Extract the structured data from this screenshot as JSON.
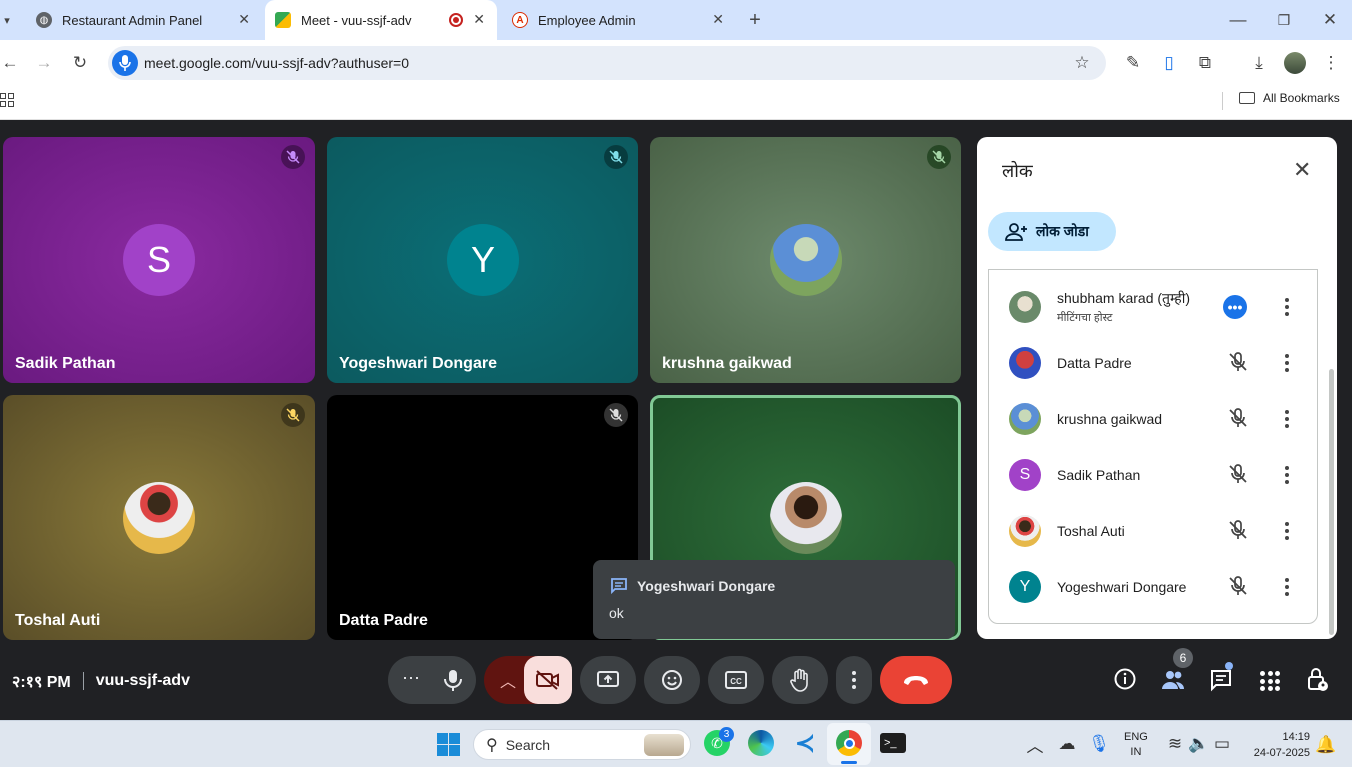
{
  "browser": {
    "tabs": [
      {
        "title": "Restaurant Admin Panel"
      },
      {
        "title": "Meet - vuu-ssjf-adv"
      },
      {
        "title": "Employee Admin"
      }
    ],
    "url": "meet.google.com/vuu-ssjf-adv?authuser=0",
    "bookmarks_label": "All Bookmarks"
  },
  "tiles": [
    {
      "name": "Sadik Pathan",
      "avatar_letter": "S",
      "color": "#a142c8"
    },
    {
      "name": "Yogeshwari Dongare",
      "avatar_letter": "Y",
      "color": "#00838f"
    },
    {
      "name": "krushna gaikwad"
    },
    {
      "name": "Toshal Auti"
    },
    {
      "name": "Datta Padre"
    },
    {
      "name": ""
    }
  ],
  "chat_toast": {
    "sender": "Yogeshwari Dongare",
    "message": "ok"
  },
  "people_panel": {
    "title": "लोक",
    "add_people_label": "लोक जोडा",
    "participants": [
      {
        "name": "shubham karad (तुम्ही)",
        "subtitle": "मीटिंगचा होस्ट",
        "avatar_letter": ""
      },
      {
        "name": "Datta Padre",
        "subtitle": "",
        "avatar_letter": ""
      },
      {
        "name": "krushna gaikwad",
        "subtitle": "",
        "avatar_letter": ""
      },
      {
        "name": "Sadik Pathan",
        "subtitle": "",
        "avatar_letter": "S",
        "color": "#a142c8"
      },
      {
        "name": "Toshal Auti",
        "subtitle": "",
        "avatar_letter": ""
      },
      {
        "name": "Yogeshwari Dongare",
        "subtitle": "",
        "avatar_letter": "Y",
        "color": "#00838f"
      }
    ]
  },
  "meeting_info": {
    "time": "२:१९ PM",
    "code": "vuu-ssjf-adv",
    "participant_count": "6"
  },
  "taskbar": {
    "search_placeholder": "Search",
    "whatsapp_badge": "3",
    "lang_top": "ENG",
    "lang_bottom": "IN",
    "clock_time": "14:19",
    "clock_date": "24-07-2025"
  },
  "colors": {
    "end_call": "#ea4335",
    "accent_blue": "#1a73e8",
    "panel_chip": "#c2e7ff"
  }
}
